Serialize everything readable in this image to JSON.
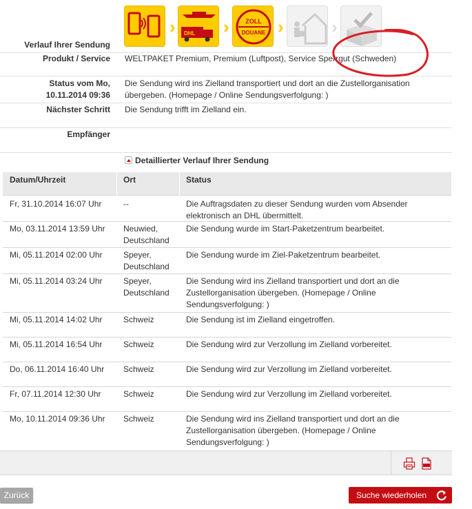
{
  "shipment": {
    "progress_label": "Verlauf Ihrer Sendung",
    "steps": [
      {
        "name": "Auftragsdaten",
        "icon": "phone-transmit-icon",
        "active": true
      },
      {
        "name": "Transport",
        "icon": "plane-truck-icon",
        "active": true
      },
      {
        "name": "Zoll",
        "icon": "zoll-douane-icon",
        "active": true,
        "line1": "ZOLL",
        "line2": "DOUANE"
      },
      {
        "name": "Zustellung",
        "icon": "house-courier-icon",
        "active": false
      },
      {
        "name": "Zugestellt",
        "icon": "checkmark-box-icon",
        "active": false
      }
    ],
    "product_label": "Produkt / Service",
    "product_value": "WELTPAKET Premium, Premium (Luftpost), Service Sperrgut (Schweden)",
    "status_label": "Status vom Mo, 10.11.2014 09:36",
    "status_label_line1": "Status vom Mo,",
    "status_label_line2": "10.11.2014 09:36",
    "status_value": "Die Sendung wird ins Zielland transportiert und dort an die Zustellorganisation übergeben. (Homepage / Online Sendungsverfolgung: )",
    "next_label": "Nächster Schritt",
    "next_value": "Die Sendung trifft im Zielland ein.",
    "recipient_label": "Empfänger",
    "recipient_value": ""
  },
  "details": {
    "title": "Detaillierter Verlauf Ihrer Sendung",
    "columns": [
      "Datum/Uhrzeit",
      "Ort",
      "Status"
    ],
    "rows": [
      {
        "date": "Fr, 31.10.2014 16:07 Uhr",
        "place": "--",
        "status": "Die Auftragsdaten zu dieser Sendung wurden vom Absender elektronisch an DHL übermittelt."
      },
      {
        "date": "Mo, 03.11.2014 13:59 Uhr",
        "place": "Neuwied, Deutschland",
        "status": "Die Sendung wurde im Start-Paketzentrum bearbeitet."
      },
      {
        "date": "Mi, 05.11.2014 02:00 Uhr",
        "place": "Speyer, Deutschland",
        "status": "Die Sendung wurde im Ziel-Paketzentrum bearbeitet."
      },
      {
        "date": "Mi, 05.11.2014 03:24 Uhr",
        "place": "Speyer, Deutschland",
        "status": "Die Sendung wird ins Zielland transportiert und dort an die Zustellorganisation übergeben. (Homepage / Online Sendungsverfolgung: )"
      },
      {
        "date": "Mi, 05.11.2014 14:02 Uhr",
        "place": "Schweiz",
        "status": "Die Sendung ist im Zielland eingetroffen."
      },
      {
        "date": "Mi, 05.11.2014 16:54 Uhr",
        "place": "Schweiz",
        "status": "Die Sendung wird zur Verzollung im Zielland vorbereitet."
      },
      {
        "date": "Do, 06.11.2014 16:40 Uhr",
        "place": "Schweiz",
        "status": "Die Sendung wird zur Verzollung im Zielland vorbereitet."
      },
      {
        "date": "Fr, 07.11.2014 12:30 Uhr",
        "place": "Schweiz",
        "status": "Die Sendung wird zur Verzollung im Zielland vorbereitet."
      },
      {
        "date": "Mo, 10.11.2014 09:36 Uhr",
        "place": "Schweiz",
        "status": "Die Sendung wird ins Zielland transportiert und dort an die Zustellorganisation übergeben. (Homepage / Online Sendungsverfolgung: )"
      }
    ]
  },
  "footer": {
    "print_icon": "print-icon",
    "pdf_icon": "pdf-icon",
    "back_label": "Zurück",
    "search_again_label": "Suche wiederholen"
  },
  "colors": {
    "dhl_yellow": "#ffcc00",
    "dhl_red": "#d40511",
    "button_red": "#c40c13",
    "annotation_red": "#d61f26"
  }
}
